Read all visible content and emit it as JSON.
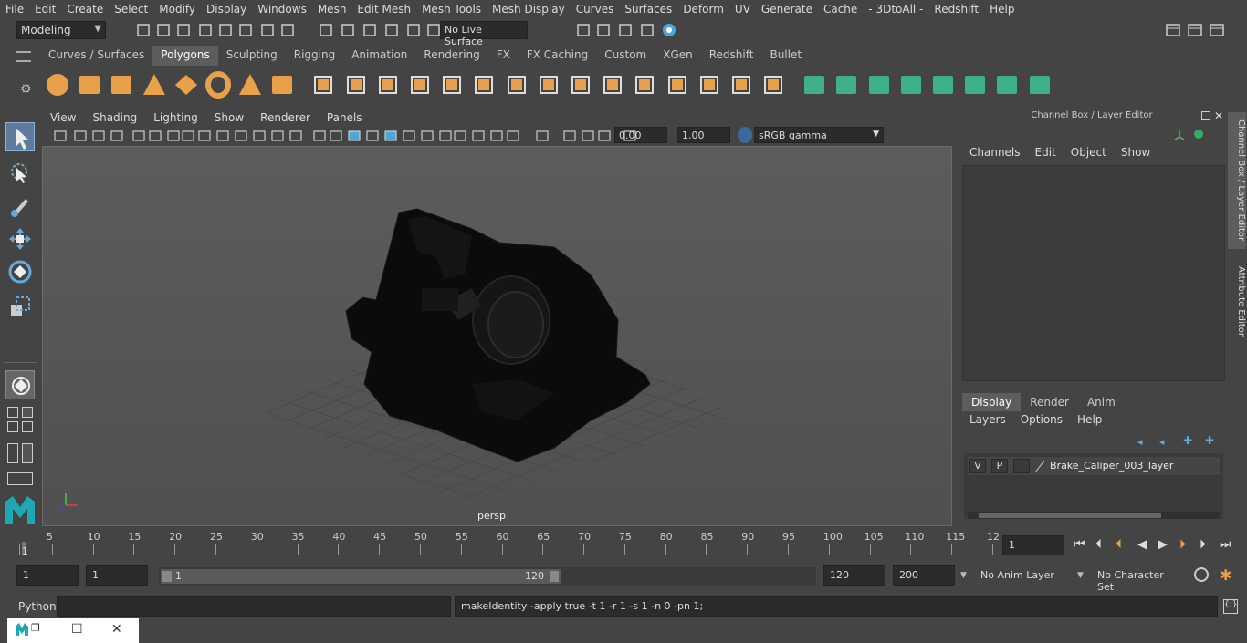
{
  "menubar": [
    "File",
    "Edit",
    "Create",
    "Select",
    "Modify",
    "Display",
    "Windows",
    "Mesh",
    "Edit Mesh",
    "Mesh Tools",
    "Mesh Display",
    "Curves",
    "Surfaces",
    "Deform",
    "UV",
    "Generate",
    "Cache",
    "- 3DtoAll -",
    "Redshift",
    "Help"
  ],
  "statusline": {
    "mode": "Modeling",
    "live_surface": "No Live Surface"
  },
  "shelf_tabs": [
    "Curves / Surfaces",
    "Polygons",
    "Sculpting",
    "Rigging",
    "Animation",
    "Rendering",
    "FX",
    "FX Caching",
    "Custom",
    "XGen",
    "Redshift",
    "Bullet"
  ],
  "shelf_active": "Polygons",
  "viewport": {
    "menu": [
      "View",
      "Shading",
      "Lighting",
      "Show",
      "Renderer",
      "Panels"
    ],
    "exposure": "0.00",
    "gamma": "1.00",
    "color_space": "sRGB gamma",
    "camera_label": "persp"
  },
  "channel_box": {
    "title": "Channel Box / Layer Editor",
    "menu": [
      "Channels",
      "Edit",
      "Object",
      "Show"
    ],
    "side_tab_1": "Channel Box / Layer Editor",
    "side_tab_2": "Attribute Editor"
  },
  "layer_editor": {
    "tabs": [
      "Display",
      "Render",
      "Anim"
    ],
    "active_tab": "Display",
    "menu": [
      "Layers",
      "Options",
      "Help"
    ],
    "layer": {
      "v": "V",
      "p": "P",
      "name": "Brake_Caliper_003_layer"
    }
  },
  "timeline": {
    "ticks": [
      "5",
      "10",
      "15",
      "20",
      "25",
      "30",
      "35",
      "40",
      "45",
      "50",
      "55",
      "60",
      "65",
      "70",
      "75",
      "80",
      "85",
      "90",
      "95",
      "100",
      "105",
      "110",
      "115",
      "12"
    ],
    "start_marker": "1",
    "current_frame": "1"
  },
  "range": {
    "start": "1",
    "start2": "1",
    "slider_start": "1",
    "slider_end": "120",
    "end": "120",
    "end2": "200",
    "anim_layer": "No Anim Layer",
    "char_set": "No Character Set"
  },
  "command": {
    "label": "Python",
    "output": "makeIdentity -apply true -t 1 -r 1 -s 1 -n 0 -pn 1;"
  },
  "colors": {
    "shelf_orange": "#e8a04a",
    "shelf_green": "#3fb08a",
    "accent_blue": "#4aa8d8"
  }
}
